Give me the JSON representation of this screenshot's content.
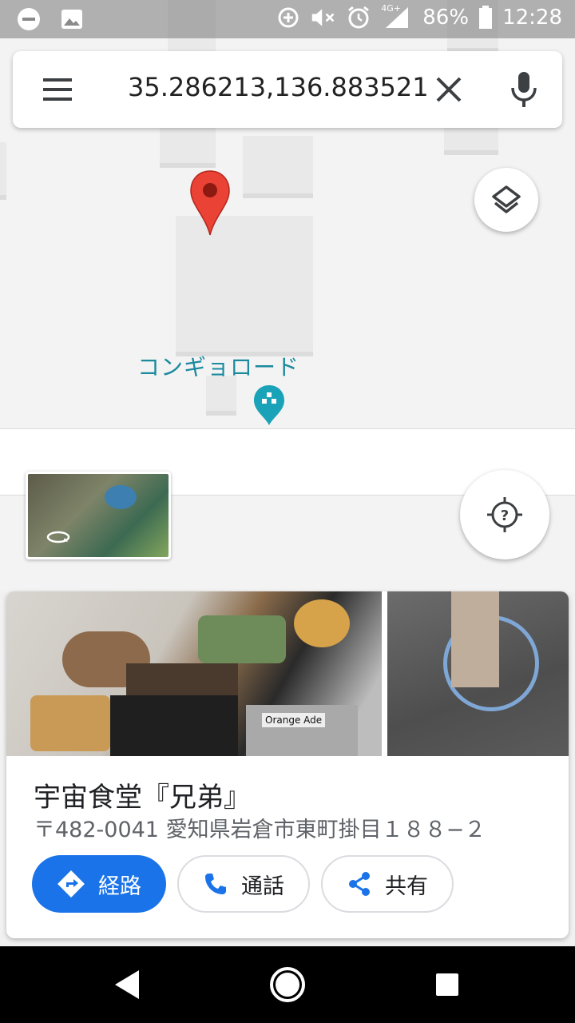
{
  "status_bar": {
    "battery_text": "86%",
    "time": "12:28",
    "network_label": "4G+"
  },
  "search": {
    "query": "35.286213,136.883521"
  },
  "map": {
    "label": "コンギョロード",
    "pin_color": "#ea4335",
    "poi_color": "#1aa3b8"
  },
  "place": {
    "name": "宇宙食堂『兄弟』",
    "address": "〒482-0041 愛知県岩倉市東町掛目１８８−２",
    "photo_label": "Orange Ade"
  },
  "actions": {
    "directions": "経路",
    "call": "通話",
    "share": "共有"
  },
  "colors": {
    "accent": "#1a73e8"
  }
}
